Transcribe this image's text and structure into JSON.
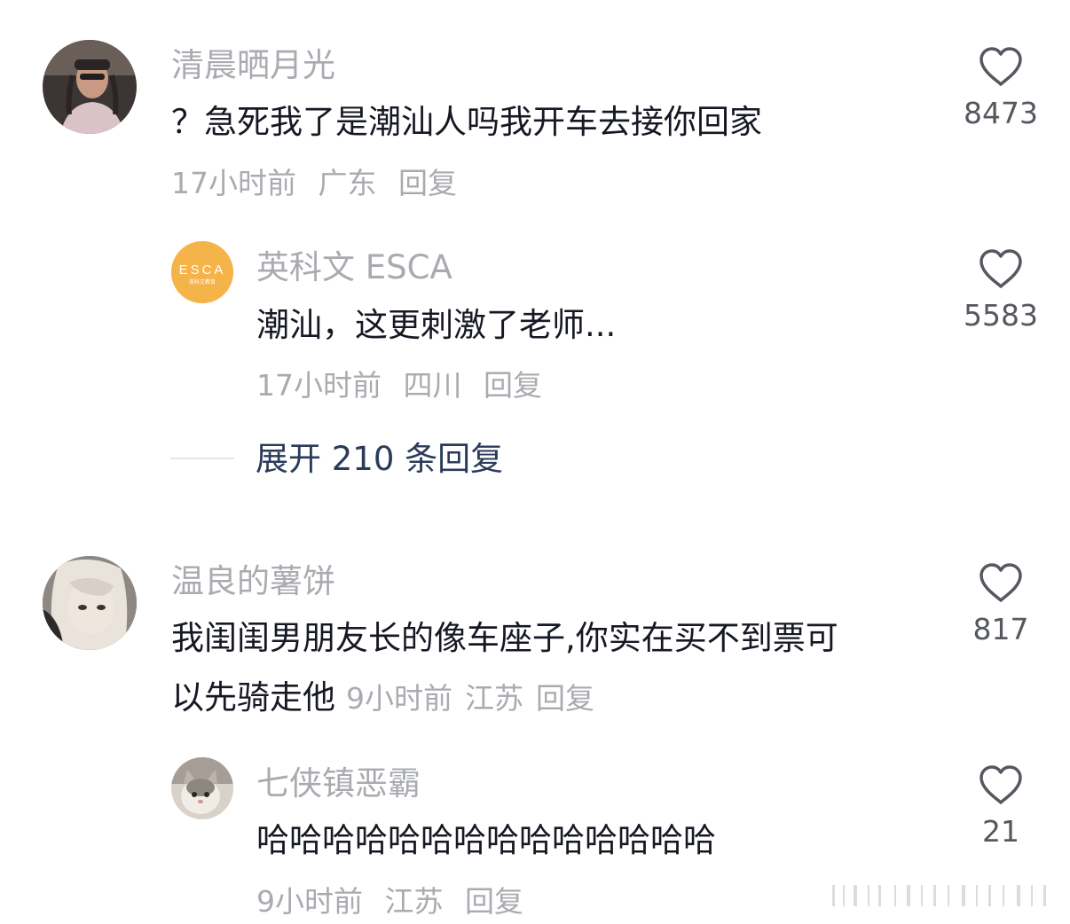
{
  "comments": [
    {
      "username": "清晨晒月光",
      "text": "？急死我了是潮汕人吗我开车去接你回家",
      "time": "17小时前",
      "location": "广东",
      "reply": "回复",
      "likes": "8473",
      "avatar_colors": [
        "#2b2b2b",
        "#d8c2c4",
        "#b38a78"
      ],
      "replies": [
        {
          "username": "英科文 ESCA",
          "text": "潮汕，这更刺激了老师...",
          "time": "17小时前",
          "location": "四川",
          "reply": "回复",
          "likes": "5583",
          "avatar_colors": [
            "#f5b44a",
            "#ffffff"
          ],
          "avatar_logo": "ESCA",
          "avatar_sub": "英科文教育"
        }
      ],
      "expand_label": "展开 210 条回复"
    },
    {
      "username": "温良的薯饼",
      "text_line1": "我闺闺男朋友长的像车座子,你实在买不到票可",
      "text_line2": "以先骑走他",
      "time": "9小时前",
      "location": "江苏",
      "reply": "回复",
      "likes": "817",
      "avatar_colors": [
        "#3a3a3a",
        "#e6dfd8",
        "#8f8a86"
      ],
      "replies": [
        {
          "username": "七侠镇恶霸",
          "text": "哈哈哈哈哈哈哈哈哈哈哈哈哈哈",
          "time": "9小时前",
          "location": "江苏",
          "reply": "回复",
          "likes": "21",
          "avatar_colors": [
            "#c9c2ba",
            "#8a8580",
            "#f2efea"
          ]
        }
      ]
    }
  ],
  "icons": {
    "like": "heart-outline-icon"
  },
  "colors": {
    "username": "#a9abb0",
    "content": "#161823",
    "meta": "#a9abb0",
    "like_count": "#55585f",
    "expand": "#2a3b5a"
  }
}
